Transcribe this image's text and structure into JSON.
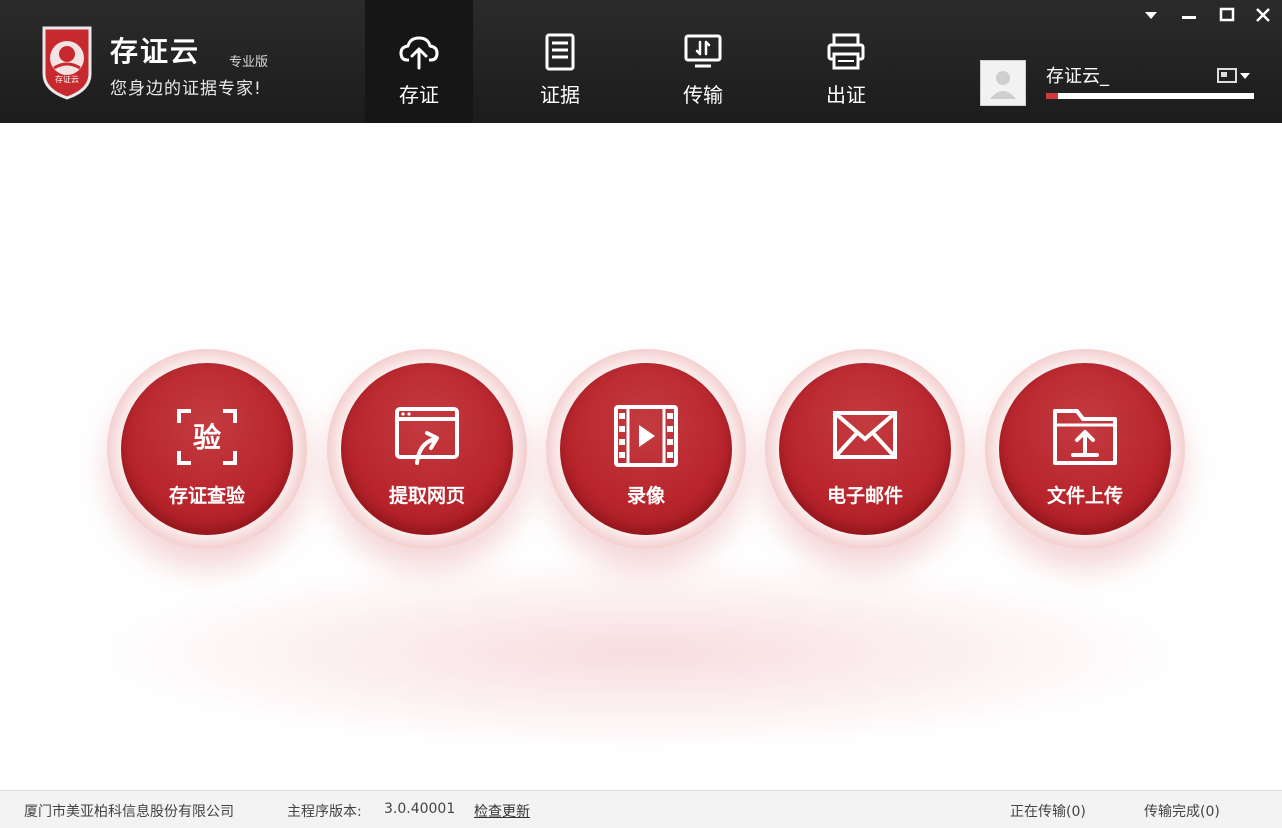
{
  "app": {
    "name": "存证云",
    "edition": "专业版",
    "slogan": "您身边的证据专家!",
    "logo_text": "存证云"
  },
  "nav": [
    {
      "label": "存证",
      "icon": "cloud-upload-icon"
    },
    {
      "label": "证据",
      "icon": "document-icon"
    },
    {
      "label": "传输",
      "icon": "transfer-monitor-icon"
    },
    {
      "label": "出证",
      "icon": "printer-icon"
    }
  ],
  "window_controls": [
    "dropdown-icon",
    "minimize-icon",
    "maximize-icon",
    "close-icon"
  ],
  "user": {
    "name": "存证云_",
    "progress": 0.06,
    "colors": {
      "progress": "#d13a3a"
    }
  },
  "actions": [
    {
      "label": "存证查验",
      "icon": "verify-scan-icon",
      "icon_text": "验"
    },
    {
      "label": "提取网页",
      "icon": "webpage-capture-icon"
    },
    {
      "label": "录像",
      "icon": "video-film-icon"
    },
    {
      "label": "电子邮件",
      "icon": "envelope-icon"
    },
    {
      "label": "文件上传",
      "icon": "folder-upload-icon"
    }
  ],
  "status": {
    "company": "厦门市美亚柏科信息股份有限公司",
    "version_label": "主程序版本:",
    "version": "3.0.40001",
    "check_update": "检查更新",
    "transferring": "正在传输(0)",
    "completed": "传输完成(0)"
  },
  "colors": {
    "topbar": "#1f1f1f",
    "accent_red": "#b8242c",
    "background": "#ffffff"
  }
}
